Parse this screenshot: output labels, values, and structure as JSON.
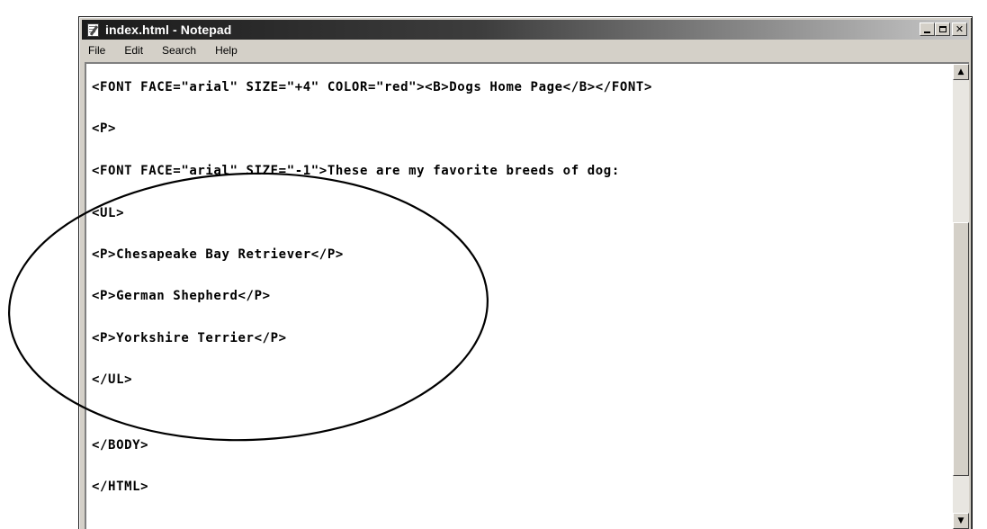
{
  "window": {
    "title": "index.html - Notepad",
    "icon": "notepad-icon"
  },
  "menu": {
    "items": [
      "File",
      "Edit",
      "Search",
      "Help"
    ]
  },
  "editor": {
    "lines": [
      "<FONT FACE=\"arial\" SIZE=\"+4\" COLOR=\"red\"><B>Dogs Home Page</B></FONT>",
      "<P>",
      "<FONT FACE=\"arial\" SIZE=\"-1\">These are my favorite breeds of dog:",
      "<UL>",
      "<P>Chesapeake Bay Retriever</P>",
      "<P>German Shepherd</P>",
      "<P>Yorkshire Terrier</P>",
      "</UL>",
      "</BODY>",
      "</HTML>"
    ]
  },
  "colors": {
    "window_face": "#d4d0c8",
    "title_gradient_start": "#1b1b1b",
    "title_gradient_end": "#c8c8c8",
    "editor_background": "#ffffff",
    "annotation_stroke": "#000000"
  },
  "icons": {
    "minimize": "minimize-icon",
    "maximize": "maximize-icon",
    "close": "close-icon",
    "scroll_up": "arrow-up-icon",
    "scroll_down": "arrow-down-icon"
  }
}
